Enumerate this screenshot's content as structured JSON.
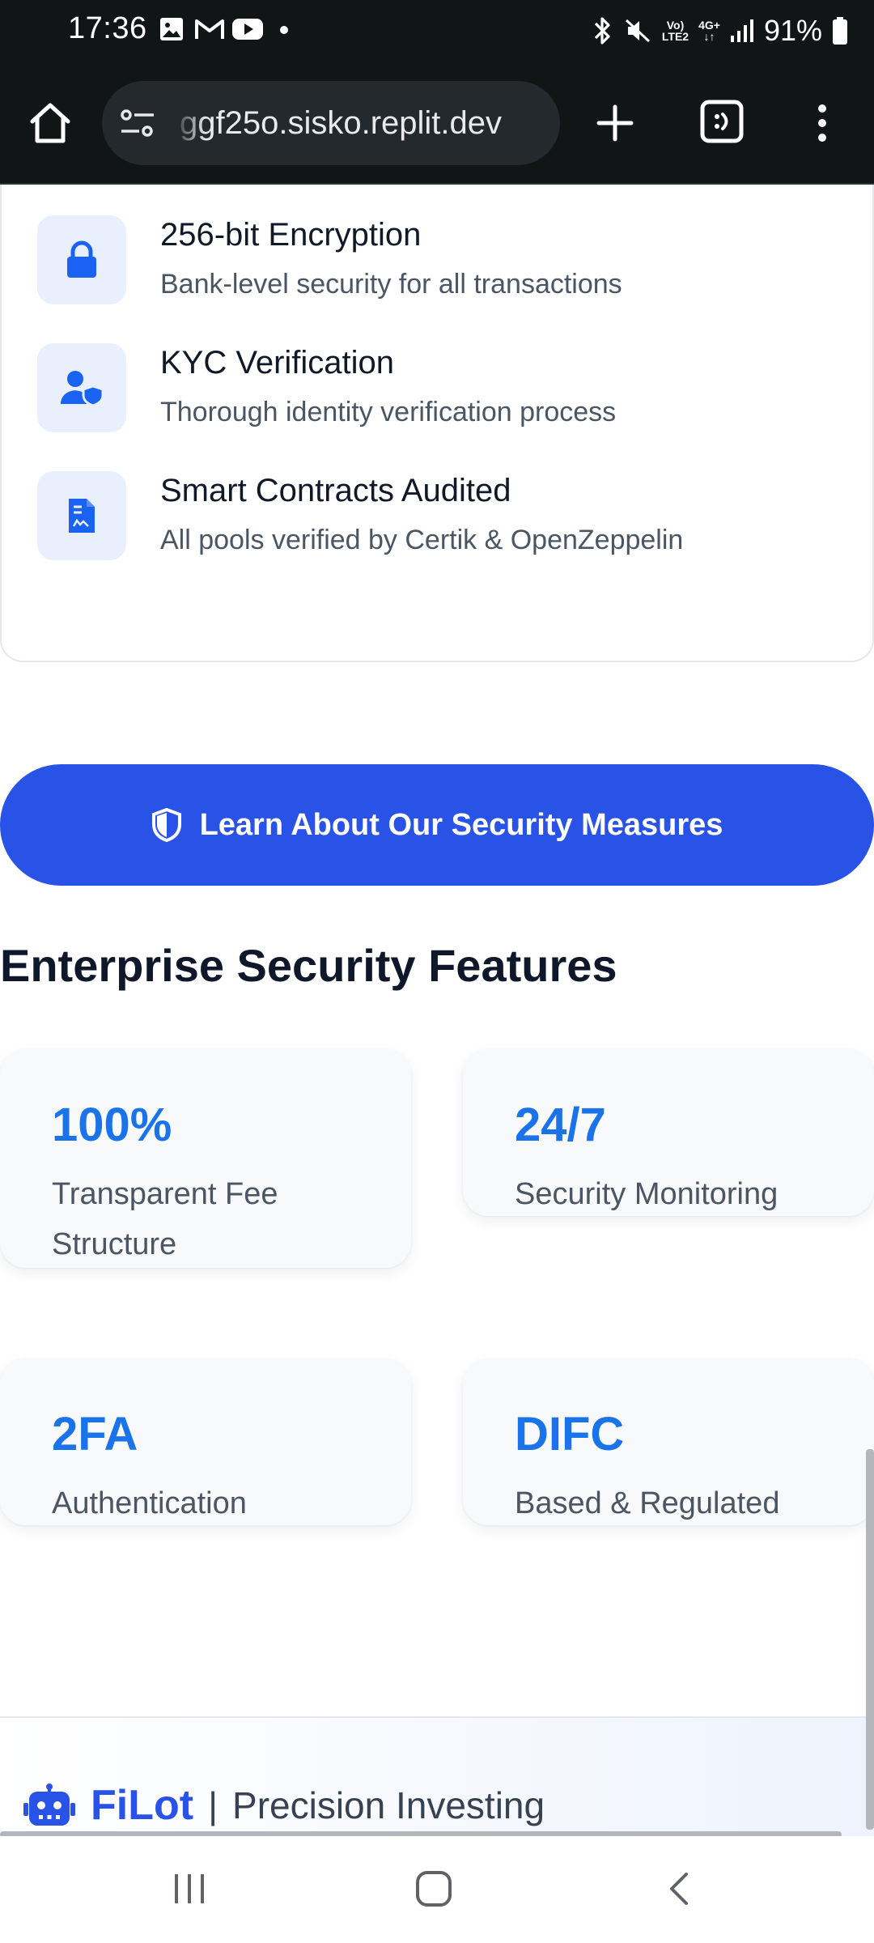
{
  "status_bar": {
    "time": "17:36",
    "battery": "91%",
    "left_icons": [
      "image-icon",
      "gmail-icon",
      "youtube-icon",
      "dot-icon"
    ],
    "right_icons": [
      "bluetooth-icon",
      "mute-icon",
      "volte-icon",
      "4g-icon",
      "signal-icon",
      "battery-icon"
    ],
    "volte_line1": "Vo)",
    "volte_line2": "LTE2",
    "net_line1": "4G+",
    "net_line2": "↓↑"
  },
  "browser": {
    "url": "ggf25o.sisko.replit.dev"
  },
  "security_list": [
    {
      "icon": "lock-icon",
      "title": "256-bit Encryption",
      "description": "Bank-level security for all transactions"
    },
    {
      "icon": "user-shield-icon",
      "title": "KYC Verification",
      "description": "Thorough identity verification process"
    },
    {
      "icon": "contract-icon",
      "title": "Smart Contracts Audited",
      "description": "All pools verified by Certik & OpenZeppelin"
    }
  ],
  "cta": {
    "label": "Learn About Our Security Measures",
    "icon": "shield-icon"
  },
  "enterprise": {
    "title": "Enterprise Security Features",
    "stats": [
      {
        "value": "100%",
        "label": "Transparent Fee Structure"
      },
      {
        "value": "24/7",
        "label": "Security Monitoring"
      },
      {
        "value": "2FA",
        "label": "Authentication"
      },
      {
        "value": "DIFC",
        "label": "Based & Regulated"
      }
    ]
  },
  "footer": {
    "brand": "FiLot",
    "separator": "|",
    "tagline": "Precision Investing",
    "icon": "robot-icon"
  },
  "colors": {
    "accent": "#2952e6",
    "stat_value": "#1a73e8",
    "icon_box_bg": "#e9effd",
    "chrome_bg": "#111516"
  }
}
